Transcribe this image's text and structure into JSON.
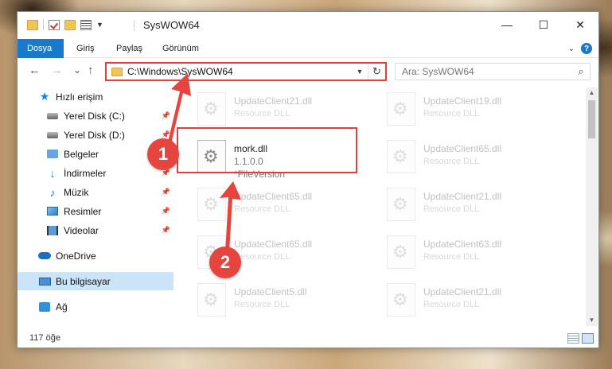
{
  "window": {
    "title": "SysWOW64",
    "controls": {
      "minimize": "—",
      "maximize": "☐",
      "close": "✕"
    }
  },
  "ribbon": {
    "tabs": [
      {
        "label": "Dosya",
        "active": true
      },
      {
        "label": "Giriş",
        "active": false
      },
      {
        "label": "Paylaş",
        "active": false
      },
      {
        "label": "Görünüm",
        "active": false
      }
    ],
    "help": "?"
  },
  "navigation": {
    "back": "←",
    "forward": "→",
    "recent": "⌄",
    "up": "↑",
    "address": "C:\\Windows\\SysWOW64",
    "refresh": "↻",
    "search_placeholder": "Ara: SysWOW64"
  },
  "sidebar": {
    "items": [
      {
        "label": "Hızlı erişim",
        "icon": "star-icon",
        "pinned": false
      },
      {
        "label": "Yerel Disk (C:)",
        "icon": "drive-icon",
        "pinned": true
      },
      {
        "label": "Yerel Disk (D:)",
        "icon": "drive-icon",
        "pinned": true
      },
      {
        "label": "Belgeler",
        "icon": "documents-folder-icon",
        "pinned": true
      },
      {
        "label": "İndirmeler",
        "icon": "downloads-icon",
        "pinned": true
      },
      {
        "label": "Müzik",
        "icon": "music-icon",
        "pinned": true
      },
      {
        "label": "Resimler",
        "icon": "pictures-icon",
        "pinned": true
      },
      {
        "label": "Videolar",
        "icon": "videos-icon",
        "pinned": true
      },
      {
        "label": "OneDrive",
        "icon": "onedrive-cloud-icon",
        "pinned": false
      },
      {
        "label": "Bu bilgisayar",
        "icon": "computer-icon",
        "pinned": false,
        "selected": true
      },
      {
        "label": "Ağ",
        "icon": "network-icon",
        "pinned": false
      }
    ]
  },
  "files": [
    {
      "name": "UpdateClient21.dll",
      "type": "Resource DLL"
    },
    {
      "name": "UpdateClient19.dll",
      "type": "Resource DLL"
    },
    {
      "name": "mork.dll",
      "version": "1.1.0.0",
      "desc": "*FileVersion",
      "highlighted": true
    },
    {
      "name": "UpdateClient65.dll",
      "type": "Resource DLL"
    },
    {
      "name": "UpdateClient65.dll",
      "type": "Resource DLL"
    },
    {
      "name": "UpdateClient21.dll",
      "type": "Resource DLL"
    },
    {
      "name": "UpdateClient65.dll",
      "type": "Resource DLL"
    },
    {
      "name": "UpdateClient63.dll",
      "type": "Resource DLL"
    },
    {
      "name": "UpdateClient5.dll",
      "type": "Resource DLL"
    },
    {
      "name": "UpdateClient21.dll",
      "type": "Resource DLL"
    }
  ],
  "status": {
    "count": "117 öğe"
  },
  "annotations": {
    "step1": "1",
    "step2": "2",
    "color": "#e6453f"
  },
  "colors": {
    "accent": "#1979ca",
    "highlight_border": "#e53c3c",
    "selection": "#cce4f7"
  }
}
